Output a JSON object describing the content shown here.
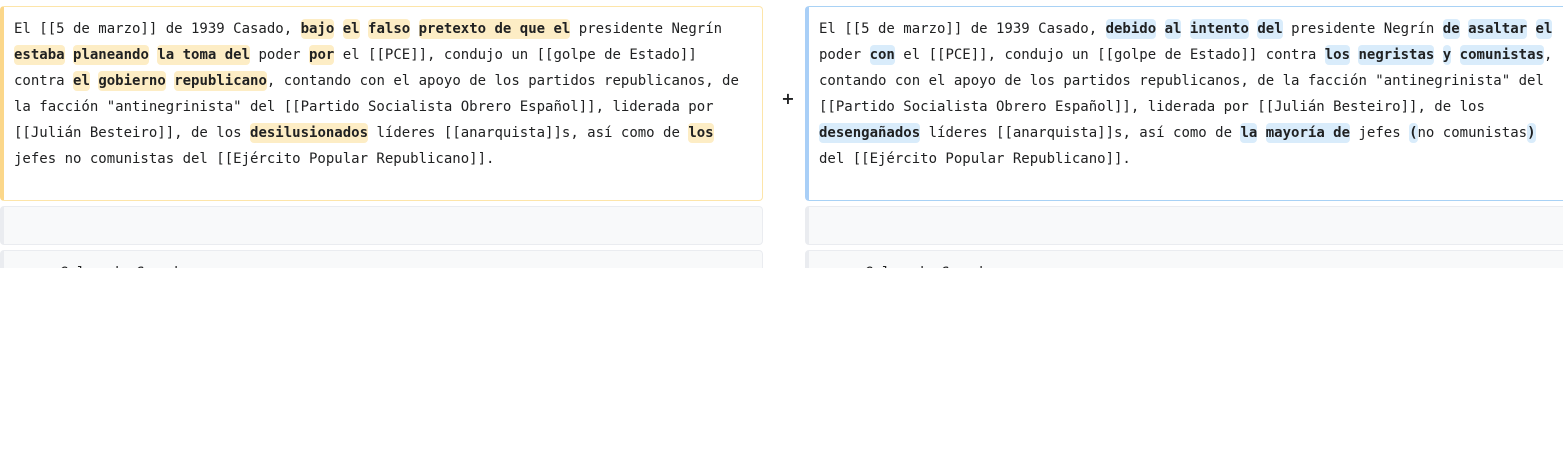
{
  "diff": {
    "marker": "+",
    "old_segments": [
      {
        "t": "El [[5 de marzo]] de 1939 Casado, ",
        "h": false
      },
      {
        "t": "bajo",
        "h": true
      },
      {
        "t": " ",
        "h": false
      },
      {
        "t": "el",
        "h": true
      },
      {
        "t": " ",
        "h": false
      },
      {
        "t": "falso",
        "h": true
      },
      {
        "t": " ",
        "h": false
      },
      {
        "t": "pretexto de que el",
        "h": true
      },
      {
        "t": " presidente Negrín ",
        "h": false
      },
      {
        "t": "estaba",
        "h": true
      },
      {
        "t": " ",
        "h": false
      },
      {
        "t": "planeando",
        "h": true
      },
      {
        "t": " ",
        "h": false
      },
      {
        "t": "la toma del",
        "h": true
      },
      {
        "t": " poder ",
        "h": false
      },
      {
        "t": "por",
        "h": true
      },
      {
        "t": " el [[PCE]], condujo un [[golpe de Estado]] contra ",
        "h": false
      },
      {
        "t": "el",
        "h": true
      },
      {
        "t": " ",
        "h": false
      },
      {
        "t": "gobierno",
        "h": true
      },
      {
        "t": " ",
        "h": false
      },
      {
        "t": "republicano",
        "h": true
      },
      {
        "t": ", contando con el apoyo de los partidos republicanos, de la facción \"antinegrinista\" del [[Partido Socialista Obrero Español]], liderada por [[Julián Besteiro]], de los ",
        "h": false
      },
      {
        "t": "desilusionados",
        "h": true
      },
      {
        "t": " líderes [[anarquista]]s, así como de ",
        "h": false
      },
      {
        "t": "los",
        "h": true
      },
      {
        "t": " jefes no comunistas del [[Ejército Popular Republicano]].",
        "h": false
      }
    ],
    "new_segments": [
      {
        "t": "El [[5 de marzo]] de 1939 Casado, ",
        "h": false
      },
      {
        "t": "debido",
        "h": true
      },
      {
        "t": " ",
        "h": false
      },
      {
        "t": "al",
        "h": true
      },
      {
        "t": " ",
        "h": false
      },
      {
        "t": "intento",
        "h": true
      },
      {
        "t": " ",
        "h": false
      },
      {
        "t": "del",
        "h": true
      },
      {
        "t": " presidente Negrín ",
        "h": false
      },
      {
        "t": "de",
        "h": true
      },
      {
        "t": " ",
        "h": false
      },
      {
        "t": "asaltar",
        "h": true
      },
      {
        "t": " ",
        "h": false
      },
      {
        "t": "el",
        "h": true
      },
      {
        "t": " poder ",
        "h": false
      },
      {
        "t": "con",
        "h": true
      },
      {
        "t": " el [[PCE]], condujo un [[golpe de Estado]] contra ",
        "h": false
      },
      {
        "t": "los",
        "h": true
      },
      {
        "t": " ",
        "h": false
      },
      {
        "t": "negristas",
        "h": true
      },
      {
        "t": " ",
        "h": false
      },
      {
        "t": "y",
        "h": true
      },
      {
        "t": " ",
        "h": false
      },
      {
        "t": "comunistas",
        "h": true
      },
      {
        "t": ", contando con el apoyo de los partidos republicanos, de la facción \"antinegrinista\" del [[Partido Socialista Obrero Español]], liderada por [[Julián Besteiro]], de los ",
        "h": false
      },
      {
        "t": "desengañados",
        "h": true
      },
      {
        "t": " líderes [[anarquista]]s, así como de ",
        "h": false
      },
      {
        "t": " la",
        "h": true
      },
      {
        "t": " ",
        "h": false
      },
      {
        "t": "mayoría de",
        "h": true
      },
      {
        "t": " jefes ",
        "h": false
      },
      {
        "t": "(",
        "h": true
      },
      {
        "t": "no comunistas",
        "h": false
      },
      {
        "t": ")",
        "h": true
      },
      {
        "t": " del [[Ejército Popular Republicano]].",
        "h": false
      }
    ],
    "context_rows": [
      {
        "left": "",
        "right": ""
      },
      {
        "left": "Golpe de Casado",
        "right": "Golpe de Casado"
      }
    ]
  }
}
